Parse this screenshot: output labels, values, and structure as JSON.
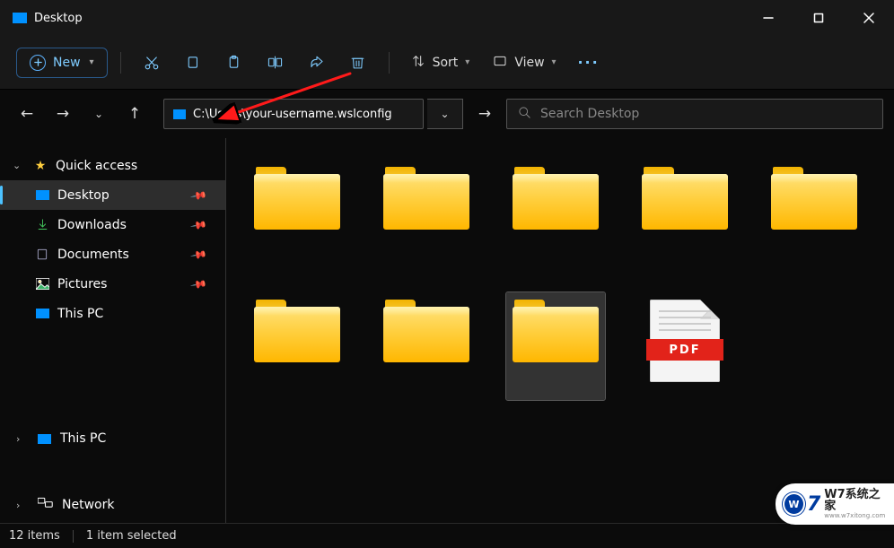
{
  "titlebar": {
    "text": "Desktop"
  },
  "toolbar": {
    "new_label": "New",
    "sort_label": "Sort",
    "view_label": "View"
  },
  "nav": {
    "address": "C:\\Users\\your-username.wslconfig",
    "search_placeholder": "Search Desktop"
  },
  "sidebar": {
    "quick_access": "Quick access",
    "items": [
      {
        "label": "Desktop",
        "active": true
      },
      {
        "label": "Downloads"
      },
      {
        "label": "Documents"
      },
      {
        "label": "Pictures"
      },
      {
        "label": "This PC"
      }
    ],
    "this_pc": "This PC",
    "network": "Network"
  },
  "content": {
    "items": [
      {
        "type": "folder"
      },
      {
        "type": "folder"
      },
      {
        "type": "folder"
      },
      {
        "type": "folder"
      },
      {
        "type": "folder"
      },
      {
        "type": "folder"
      },
      {
        "type": "folder"
      },
      {
        "type": "folder",
        "selected": true
      },
      {
        "type": "pdf",
        "badge": "PDF"
      }
    ]
  },
  "status": {
    "items": "12 items",
    "selected": "1 item selected"
  },
  "watermark": {
    "brand": "W7系统之家",
    "sub": "www.w7xitong.com"
  }
}
